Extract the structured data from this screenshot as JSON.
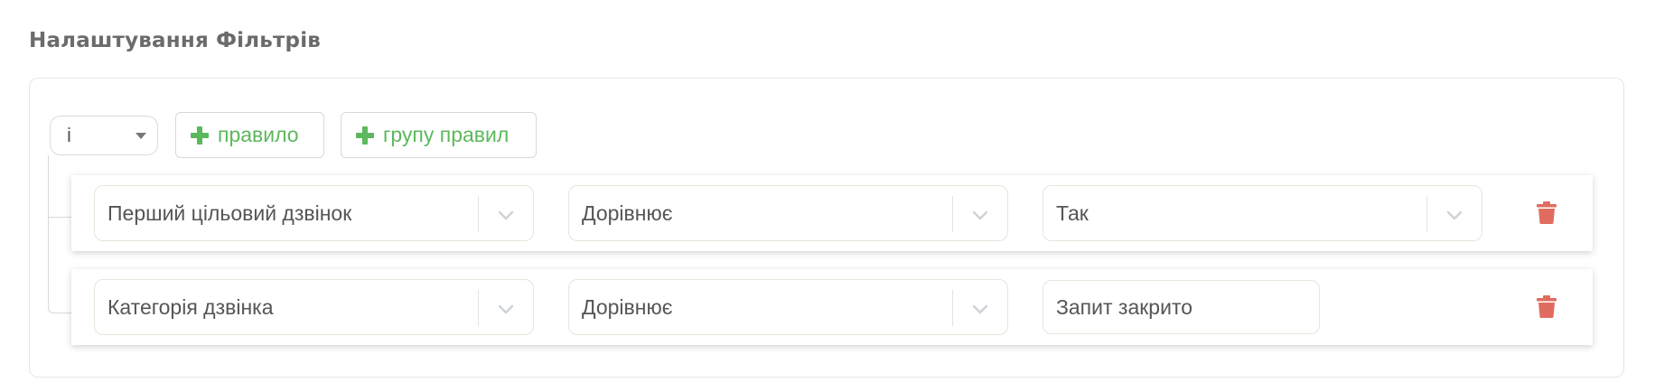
{
  "page": {
    "title": "Налаштування Фільтрів"
  },
  "builder": {
    "condition": "і",
    "add_rule_label": "правило",
    "add_group_label": "групу правил",
    "accent_color": "#5cb85c",
    "delete_color": "#e06c5f"
  },
  "rules": [
    {
      "field": "Перший цільовий дзвінок",
      "operator": "Дорівнює",
      "value": "Так",
      "value_type": "select"
    },
    {
      "field": "Категорія дзвінка",
      "operator": "Дорівнює",
      "value": "Запит закрито",
      "value_type": "text"
    }
  ],
  "icons": {
    "add": "plus-icon",
    "dropdown": "chevron-down-icon",
    "delete": "trash-icon"
  }
}
